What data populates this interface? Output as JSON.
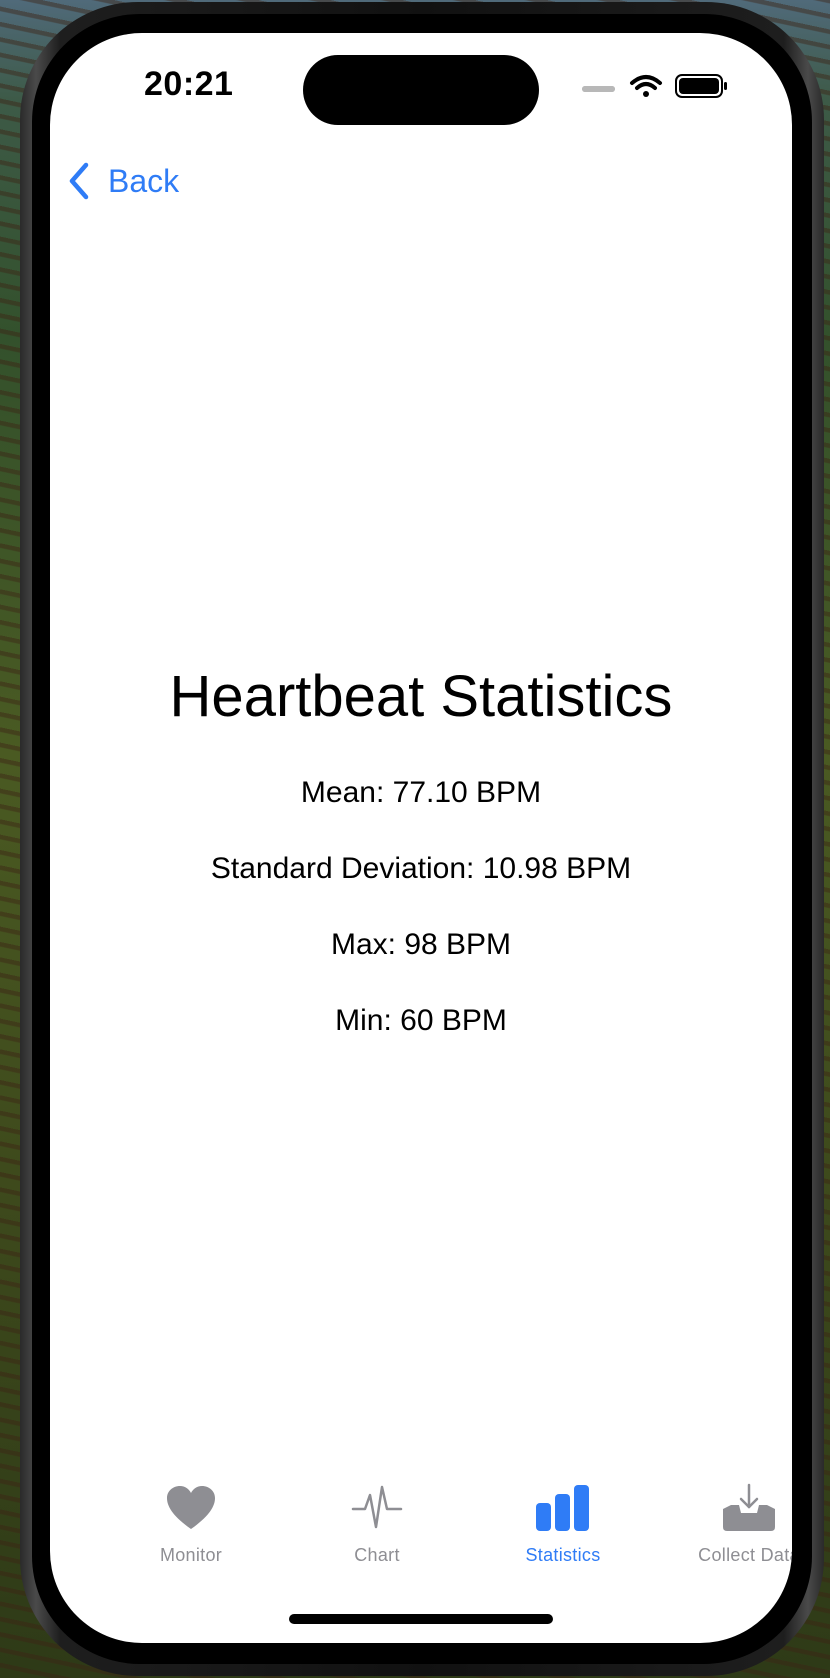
{
  "status_bar": {
    "time": "20:21",
    "icons": [
      "signal-dots-icon",
      "wifi-icon",
      "battery-icon"
    ]
  },
  "nav": {
    "back_label": "Back",
    "back_icon": "chevron-left-icon"
  },
  "main": {
    "title": "Heartbeat Statistics",
    "stats": {
      "mean": "Mean: 77.10 BPM",
      "std": "Standard Deviation: 10.98 BPM",
      "max": "Max: 98 BPM",
      "min": "Min: 60 BPM"
    }
  },
  "tabs": [
    {
      "label": "Monitor",
      "icon": "heart-icon",
      "active": false
    },
    {
      "label": "Chart",
      "icon": "waveform-icon",
      "active": false
    },
    {
      "label": "Statistics",
      "icon": "bar-chart-icon",
      "active": true
    },
    {
      "label": "Collect Data",
      "icon": "tray-download-icon",
      "active": false
    }
  ],
  "colors": {
    "accent": "#2f7cf6",
    "inactive": "#8e8e93",
    "text": "#000000",
    "background": "#ffffff"
  }
}
